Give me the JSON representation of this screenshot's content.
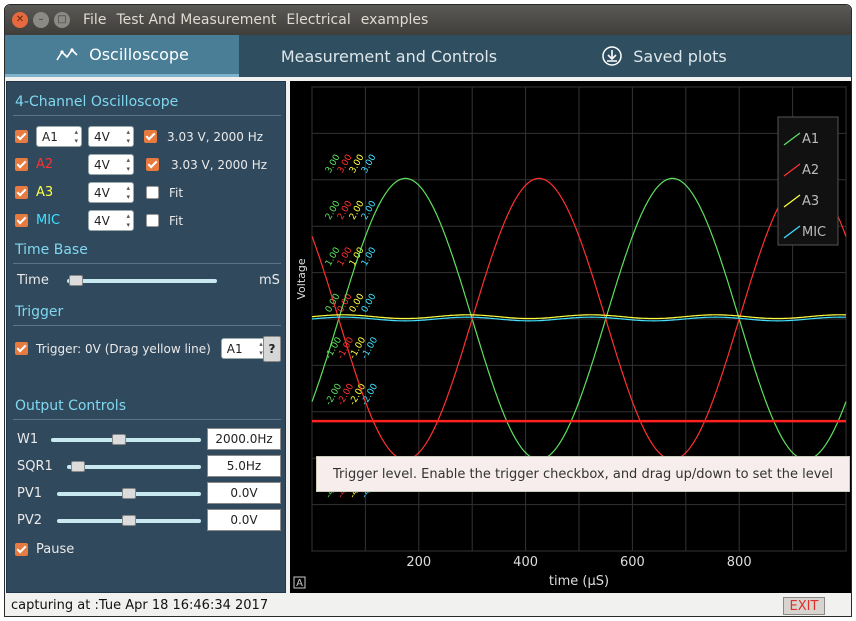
{
  "window": {
    "menu": [
      "File",
      "Test And Measurement",
      "Electrical",
      "examples"
    ]
  },
  "tabs": [
    {
      "label": "Oscilloscope",
      "icon": "oscilloscope-icon",
      "active": true
    },
    {
      "label": "Measurement and Controls",
      "icon": "",
      "active": false
    },
    {
      "label": "Saved plots",
      "icon": "download-icon",
      "active": false
    }
  ],
  "left": {
    "osc_title": "4-Channel Oscilloscope",
    "channels": [
      {
        "label": "A1",
        "range": "4V",
        "info": "3.03 V,  2000 Hz",
        "color": "#eaeaea"
      },
      {
        "label": "A2",
        "range": "4V",
        "info": "3.03 V,  2000 Hz",
        "color": "#ff3030"
      },
      {
        "label": "A3",
        "range": "4V",
        "info": "Fit",
        "color": "#ffff40"
      },
      {
        "label": "MIC",
        "range": "4V",
        "info": "Fit",
        "color": "#40e0ff"
      }
    ],
    "timebase_title": "Time Base",
    "time_label": "Time",
    "time_unit": "mS",
    "trigger_title": "Trigger",
    "trigger_label": "Trigger: 0V (Drag yellow line)",
    "trigger_channel": "A1",
    "help_label": "?",
    "output_title": "Output Controls",
    "outputs": [
      {
        "label": "W1",
        "value": "2000.0Hz",
        "level": 0.45
      },
      {
        "label": "SQR1",
        "value": "5.0Hz",
        "level": 0.03
      },
      {
        "label": "PV1",
        "value": "0.0V",
        "level": 0.5
      },
      {
        "label": "PV2",
        "value": "0.0V",
        "level": 0.5
      }
    ],
    "pause_label": "Pause"
  },
  "chart_data": {
    "type": "line",
    "xlabel": "time (µS)",
    "ylabel": "Voltage",
    "xlim": [
      0,
      1000
    ],
    "ylim": [
      -5,
      5
    ],
    "x_ticks": [
      200,
      400,
      600,
      800
    ],
    "grid": true,
    "legend": "top-right",
    "series": [
      {
        "name": "A1",
        "color": "#5fe05f",
        "kind": "sine",
        "amplitude": 3.03,
        "freq_hz": 2000,
        "phase_deg": -36
      },
      {
        "name": "A2",
        "color": "#ff3030",
        "kind": "sine",
        "amplitude": 3.03,
        "freq_hz": 2000,
        "phase_deg": 144
      },
      {
        "name": "A3",
        "color": "#ffff40",
        "kind": "flat",
        "value": 0.05
      },
      {
        "name": "MIC",
        "color": "#40e0ff",
        "kind": "flat",
        "value": 0.0
      }
    ],
    "axis_labels": [
      {
        "color": "#5fe05f",
        "values": [
          "3.00",
          "2.00",
          "1.00",
          "0.00",
          "-1.00",
          "-2.00",
          "-4.00"
        ]
      },
      {
        "color": "#ff3030",
        "values": [
          "3.00",
          "2.00",
          "1.00",
          "0.00",
          "-1.00",
          "-2.00",
          "-4.00"
        ]
      },
      {
        "color": "#ffff40",
        "values": [
          "3.00",
          "2.00",
          "1.00",
          "0.00",
          "-1.00",
          "-2.00",
          "-4.00"
        ]
      },
      {
        "color": "#40e0ff",
        "values": [
          "3.00",
          "2.00",
          "1.00",
          "0.00",
          "-1.00",
          "-2.00",
          "-4.00"
        ]
      }
    ],
    "trigger_level": -2.2,
    "corner_label": "A"
  },
  "tooltip": "Trigger level. Enable the trigger checkbox, and drag up/down to set the level",
  "status": {
    "text": "capturing at :Tue Apr 18 16:46:34 2017",
    "exit_label": "EXIT"
  }
}
